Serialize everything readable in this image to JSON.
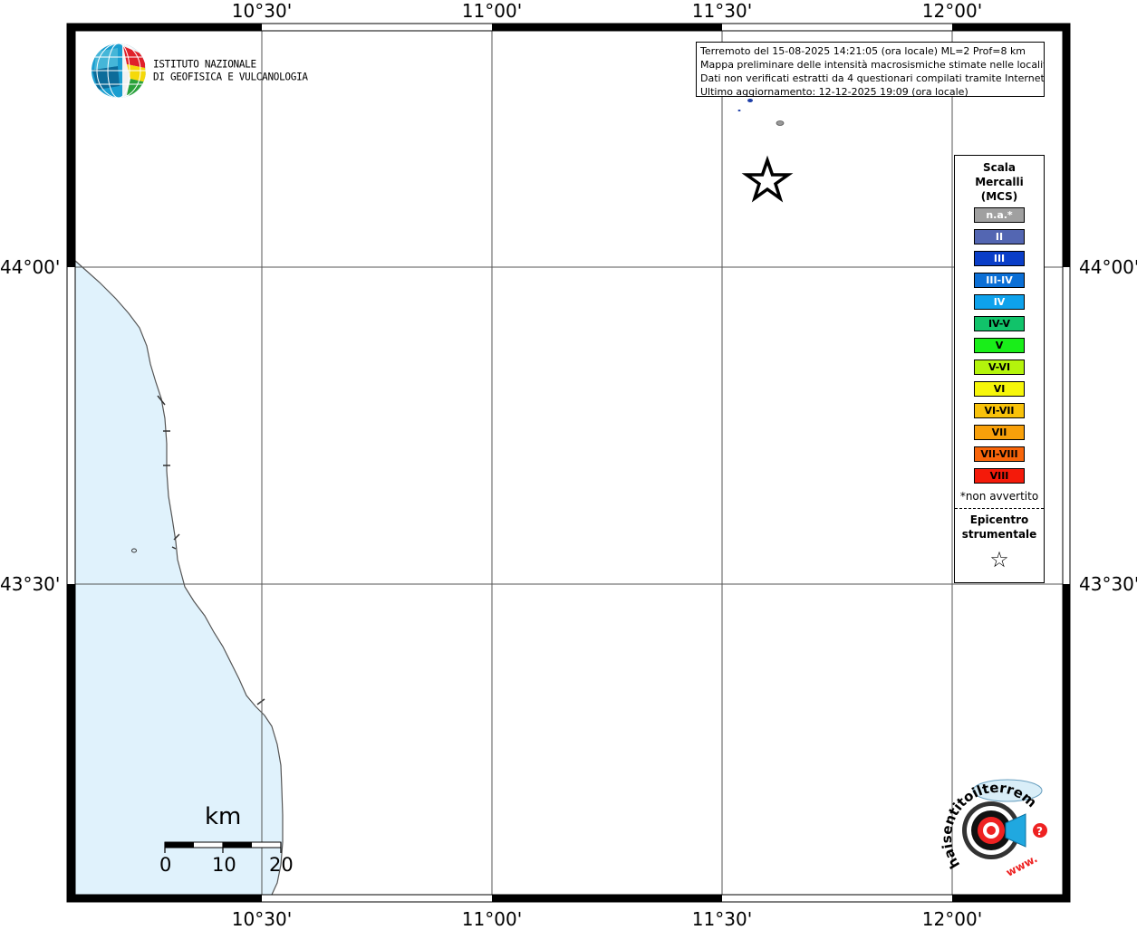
{
  "map": {
    "lon_ticks_top": [
      "10°30'",
      "11°00'",
      "11°30'",
      "12°00'"
    ],
    "lon_ticks_bottom": [
      "10°30'",
      "11°00'",
      "11°30'",
      "12°00'"
    ],
    "lat_ticks_left": [
      "44°00'",
      "43°30'"
    ],
    "lat_ticks_right": [
      "44°00'",
      "43°30'"
    ],
    "sea_color": "#e0f2fc",
    "epicenter_marker": "star-icon"
  },
  "info": {
    "line1": "Terremoto del 15-08-2025 14:21:05 (ora locale) ML=2 Prof=8 km",
    "line2": "Mappa preliminare delle intensità macrosismiche stimate nelle località",
    "line3": "Dati non verificati estratti da 4 questionari compilati tramite Internet.",
    "line4": "Ultimo aggiornamento: 12-12-2025 19:09 (ora locale)"
  },
  "legend": {
    "title1": "Scala",
    "title2": "Mercalli",
    "title3": "(MCS)",
    "items": [
      {
        "label": "n.a.*",
        "color": "#a0a0a0",
        "text_color": "#ffffff"
      },
      {
        "label": "II",
        "color": "#5366b2",
        "text_color": "#ffffff"
      },
      {
        "label": "III",
        "color": "#0a3ec8",
        "text_color": "#ffffff"
      },
      {
        "label": "III-IV",
        "color": "#0b6fd6",
        "text_color": "#ffffff"
      },
      {
        "label": "IV",
        "color": "#0ea2ec",
        "text_color": "#ffffff"
      },
      {
        "label": "IV-V",
        "color": "#11c36a",
        "text_color": "#000000"
      },
      {
        "label": "V",
        "color": "#19ee19",
        "text_color": "#000000"
      },
      {
        "label": "V-VI",
        "color": "#b4f40c",
        "text_color": "#000000"
      },
      {
        "label": "VI",
        "color": "#f6f60a",
        "text_color": "#000000"
      },
      {
        "label": "VI-VII",
        "color": "#f8c20a",
        "text_color": "#000000"
      },
      {
        "label": "VII",
        "color": "#f8a00a",
        "text_color": "#000000"
      },
      {
        "label": "VII-VIII",
        "color": "#f8650a",
        "text_color": "#000000"
      },
      {
        "label": "VIII",
        "color": "#f41a0a",
        "text_color": "#000000"
      }
    ],
    "note": "*non avvertito",
    "epi1": "Epicentro",
    "epi2": "strumentale",
    "star": "☆"
  },
  "scalebar": {
    "unit": "km",
    "ticks": [
      "0",
      "10",
      "20"
    ]
  },
  "logos": {
    "ingv_line1": "ISTITUTO NAZIONALE",
    "ingv_line2": "DI GEOFISICA E VULCANOLOGIA",
    "hai_arc": "haisentitoilterremoto.it",
    "hai_www": "www."
  }
}
